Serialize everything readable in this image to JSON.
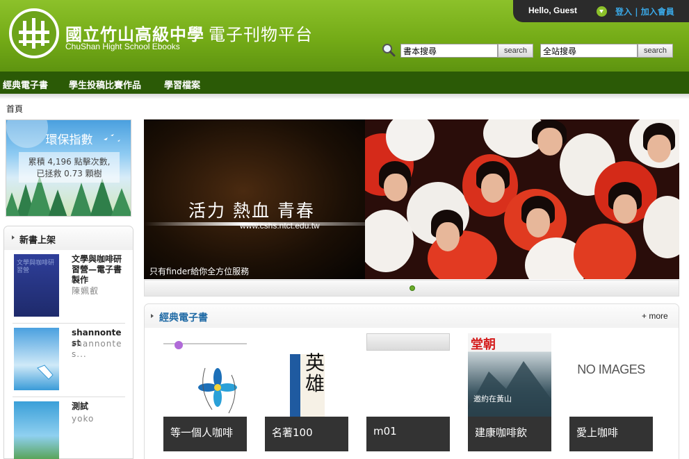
{
  "header": {
    "title": "國立竹山高級中學",
    "title_sub": "電子刊物平台",
    "subtitle_en": "ChuShan Hight School Ebooks",
    "greeting": "Hello, Guest",
    "login": "登入",
    "separator": "|",
    "register": "加入會員",
    "book_search_value": "書本搜尋",
    "site_search_value": "全站搜尋",
    "search_label": "search"
  },
  "nav": {
    "items": [
      "經典電子書",
      "學生投稿比賽作品",
      "學習檔案"
    ]
  },
  "breadcrumb": "首頁",
  "eco": {
    "title": "環保指數",
    "line1": "累積 4,196 點擊次數,",
    "line2": "已拯救 0.73 顆樹"
  },
  "new_books": {
    "title": "新書上架",
    "items": [
      {
        "title": "文學與咖啡研習營—電子書製作",
        "author": "陳姵叡",
        "cover_text": "文學與咖啡研習營"
      },
      {
        "title": "shannontest",
        "author": "shannontes..."
      },
      {
        "title": "測試",
        "author": "yoko"
      }
    ]
  },
  "banner": {
    "slogan": "活力 熱血 青春",
    "url": "www.cshs.ntct.edu.tw",
    "caption": "只有finder給你全方位服務"
  },
  "classic": {
    "title": "經典電子書",
    "more": "+ more",
    "books": [
      {
        "label": "等一個人咖啡"
      },
      {
        "label": "名著100",
        "cover_text": "英雄"
      },
      {
        "label": "m01"
      },
      {
        "label": "建康咖啡飲",
        "cover_text": "堂朝",
        "cover_sub": "邀約在黃山"
      },
      {
        "label": "愛上咖啡",
        "cover_text": "NO IMAGES"
      }
    ]
  },
  "colors": {
    "header_green": "#74ab17",
    "nav_green": "#2b5a06",
    "link_blue": "#3aa9e8",
    "title_blue": "#1f6aa5"
  }
}
